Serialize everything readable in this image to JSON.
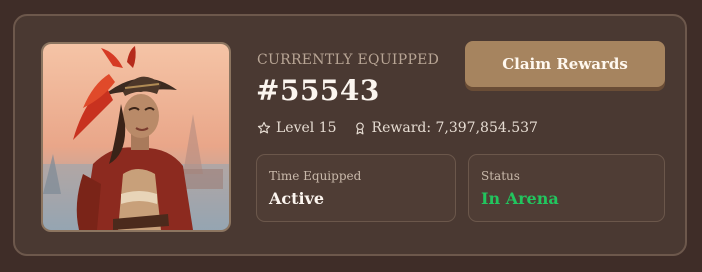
{
  "card": {
    "eyebrow": "CURRENTLY EQUIPPED",
    "asset_id": "#55543",
    "level_text": "Level 15",
    "reward_text": "Reward: 7,397,854.537",
    "level_icon": "star-outline-icon",
    "reward_icon": "award-ribbon-icon"
  },
  "actions": {
    "claim_label": "Claim Rewards"
  },
  "stats": [
    {
      "label": "Time Equipped",
      "value": "Active"
    },
    {
      "label": "Status",
      "value": "In Arena",
      "value_color": "#22c55e"
    }
  ],
  "colors": {
    "background": "#3f2d28",
    "card": "#4a3932",
    "accent_button": "#a6845f",
    "status_green": "#22c55e"
  }
}
